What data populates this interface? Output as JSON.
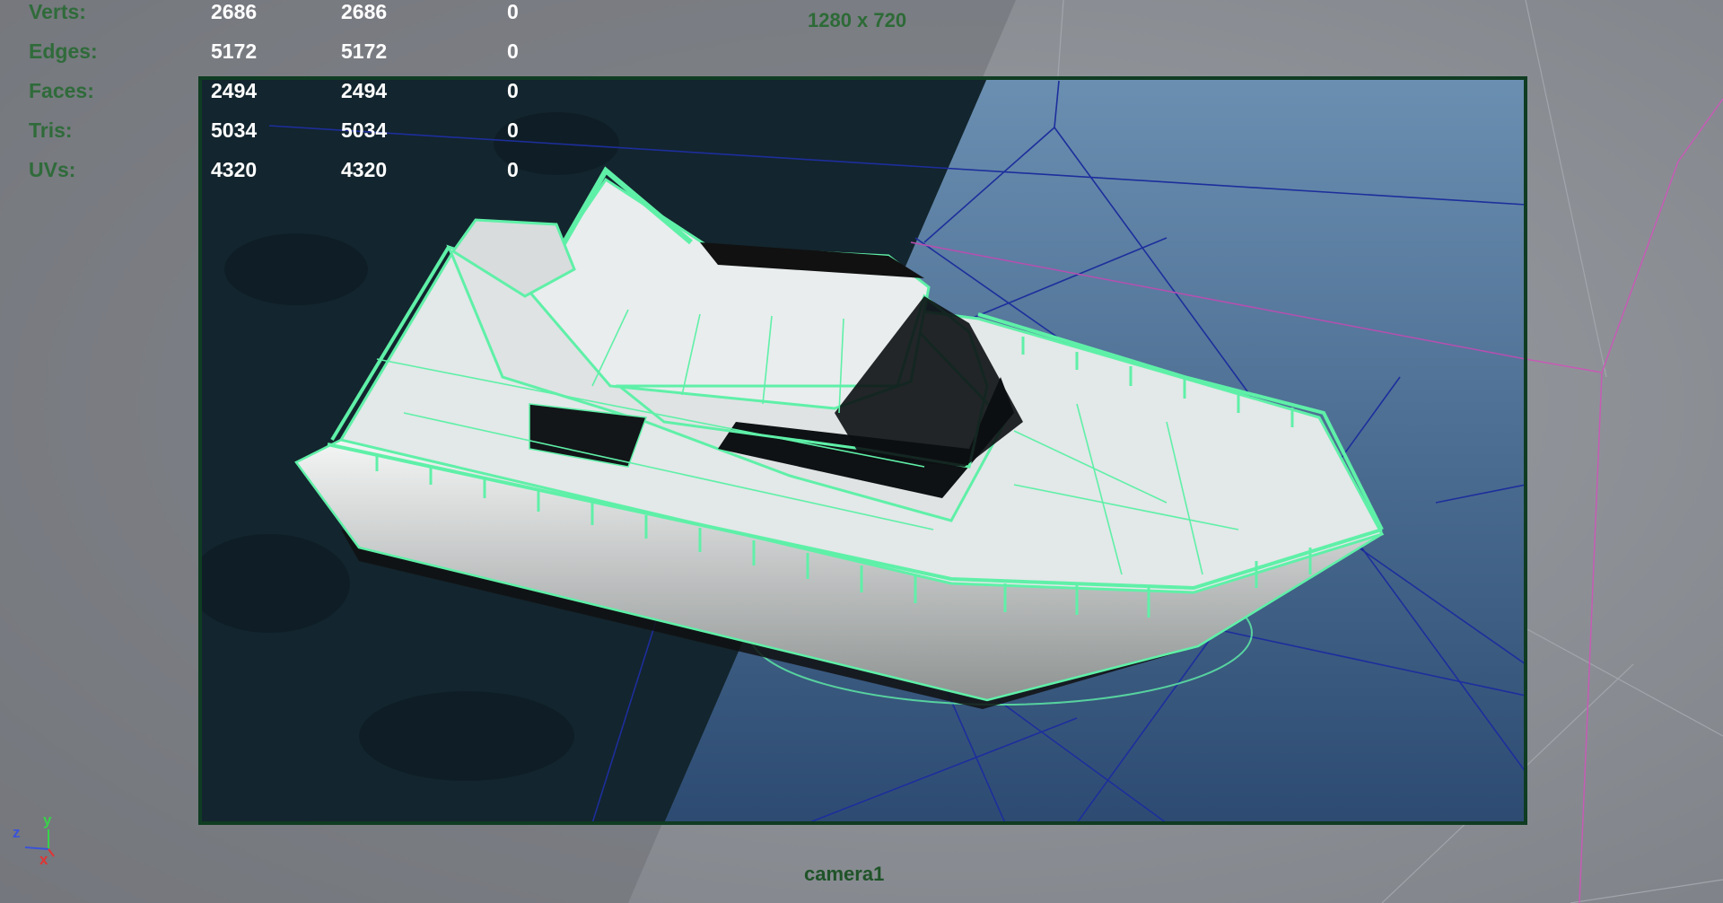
{
  "stats": {
    "rows": [
      {
        "label": "Verts:",
        "a": "2686",
        "b": "2686",
        "c": "0"
      },
      {
        "label": "Edges:",
        "a": "5172",
        "b": "5172",
        "c": "0"
      },
      {
        "label": "Faces:",
        "a": "2494",
        "b": "2494",
        "c": "0"
      },
      {
        "label": "Tris:",
        "a": "5034",
        "b": "5034",
        "c": "0"
      },
      {
        "label": "UVs:",
        "a": "4320",
        "b": "4320",
        "c": "0"
      }
    ]
  },
  "resolution_gate": "1280 x 720",
  "camera_name": "camera1",
  "axis": {
    "x": "x",
    "y": "y",
    "z": "z"
  },
  "colors": {
    "wireframe": "#5ff0a8",
    "gate_border": "#0f3c22",
    "label": "#2f6b3a",
    "value": "#ffffff"
  }
}
